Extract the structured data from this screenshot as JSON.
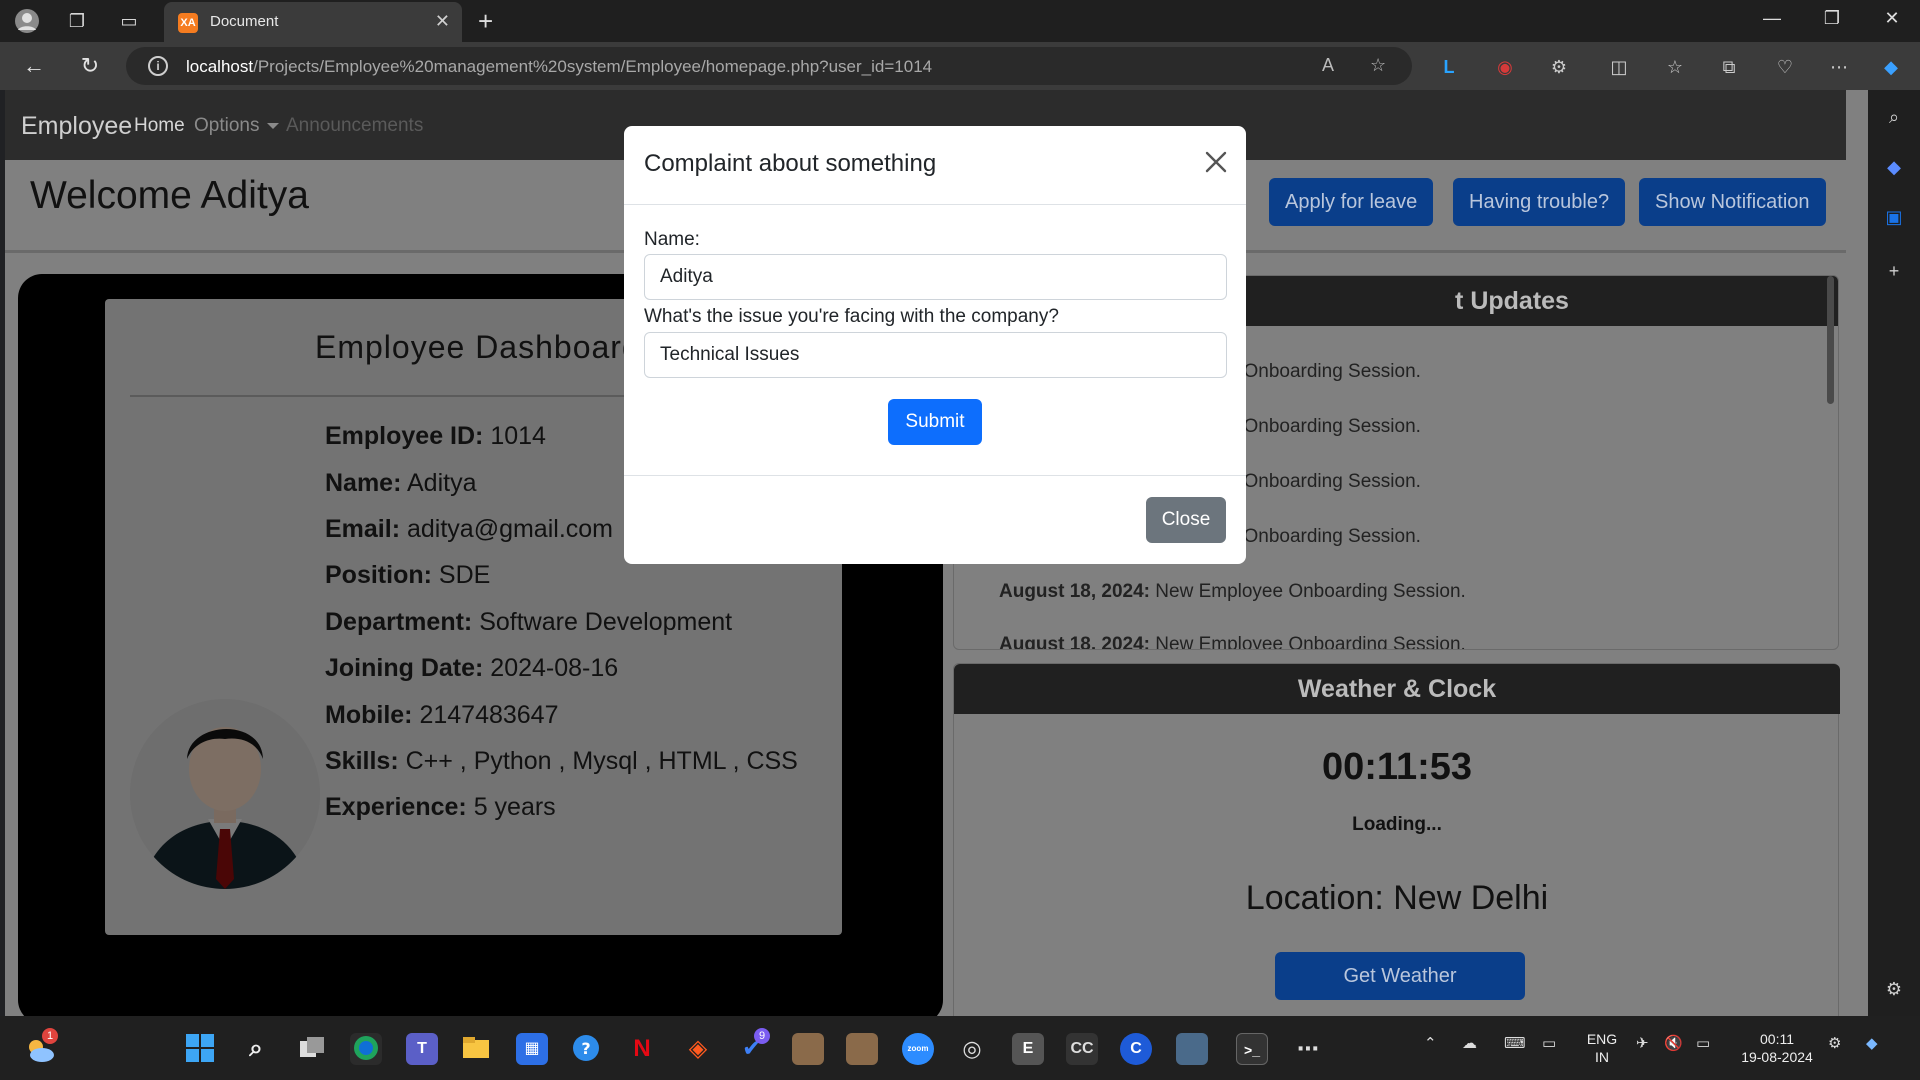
{
  "browser": {
    "tab_title": "Document",
    "tab_favicon": "XA",
    "url_host": "localhost",
    "url_path": "/Projects/Employee%20management%20system/Employee/homepage.php?user_id=1014"
  },
  "navbar": {
    "brand": "Employee",
    "links": [
      "Home",
      "Options",
      "Announcements"
    ]
  },
  "header": {
    "welcome": "Welcome Aditya",
    "buttons": [
      "Apply for leave",
      "Having trouble?",
      "Show Notification"
    ]
  },
  "dashboard": {
    "title": "Employee Dashboard",
    "fields": [
      {
        "label": "Employee ID:",
        "value": "1014"
      },
      {
        "label": "Name:",
        "value": "Aditya"
      },
      {
        "label": "Email:",
        "value": "aditya@gmail.com"
      },
      {
        "label": "Position:",
        "value": "SDE"
      },
      {
        "label": "Department:",
        "value": "Software Development"
      },
      {
        "label": "Joining Date:",
        "value": "2024-08-16"
      },
      {
        "label": "Mobile:",
        "value": "2147483647"
      },
      {
        "label": "Skills:",
        "value": "C++ , Python , Mysql , HTML , CSS"
      },
      {
        "label": "Experience:",
        "value": "5 years"
      }
    ]
  },
  "updates": {
    "title_visible": "t Updates",
    "items": [
      {
        "date": "",
        "text": "oyee Onboarding Session."
      },
      {
        "date": "",
        "text": "oyee Onboarding Session."
      },
      {
        "date": "",
        "text": "oyee Onboarding Session."
      },
      {
        "date": "",
        "text": "oyee Onboarding Session."
      },
      {
        "date": "August 18, 2024:",
        "text": "New Employee Onboarding Session."
      },
      {
        "date": "August 18, 2024:",
        "text": "New Employee Onboarding Session."
      }
    ]
  },
  "weather": {
    "title": "Weather & Clock",
    "clock": "00:11:53",
    "loading": "Loading...",
    "location": "Location: New Delhi",
    "button": "Get Weather"
  },
  "modal": {
    "title": "Complaint about something",
    "name_label": "Name:",
    "name_value": "Aditya",
    "issue_label": "What's the issue you're facing with the company?",
    "issue_value": "Technical Issues",
    "submit": "Submit",
    "close": "Close"
  },
  "taskbar": {
    "weather_badge": "1",
    "todo_badge": "9",
    "lang_line1": "ENG",
    "lang_line2": "IN",
    "time": "00:11",
    "date": "19-08-2024",
    "app_letters": {
      "e": "E",
      "cc": "CC",
      "c": "C",
      "zoom": "zoom"
    }
  },
  "colors": {
    "primary": "#0d6efd",
    "secondary": "#6c757d",
    "navbar": "#212529",
    "overlay_backdrop": "rgba(0,0,0,0.5)"
  }
}
